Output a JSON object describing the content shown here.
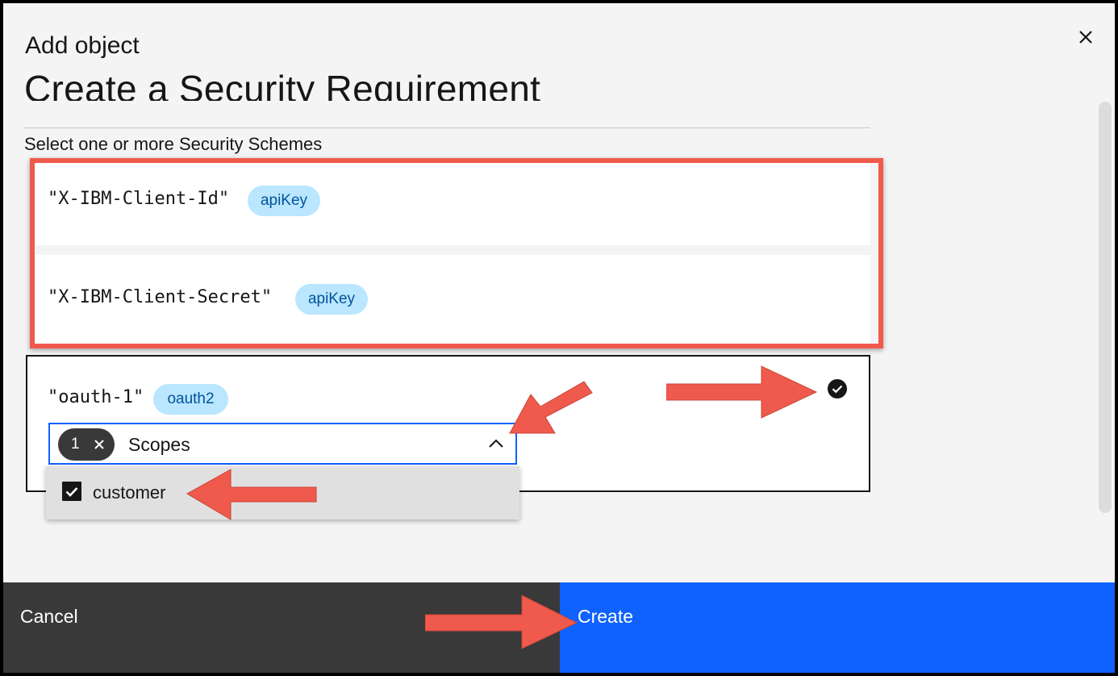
{
  "modal": {
    "label": "Add object",
    "heading": "Create a Security Requirement",
    "instruction": "Select one or more Security Schemes"
  },
  "schemes": [
    {
      "name": "\"X-IBM-Client-Id\"",
      "type": "apiKey"
    },
    {
      "name": "\"X-IBM-Client-Secret\"",
      "type": "apiKey"
    },
    {
      "name": "\"oauth-1\"",
      "type": "oauth2",
      "selected": true
    }
  ],
  "scopes": {
    "selected_count": "1",
    "label": "Scopes",
    "options": [
      {
        "label": "customer",
        "checked": true
      }
    ]
  },
  "footer": {
    "cancel_label": "Cancel",
    "create_label": "Create"
  },
  "colors": {
    "primary": "#0f62fe",
    "tag_bg": "#bae6ff",
    "tag_text": "#00539a",
    "annotation": "#ef5a4c",
    "dark_button": "#393939"
  },
  "icons": [
    "close-icon",
    "checkmark-filled-icon",
    "clear-icon",
    "chevron-up-icon",
    "checkbox-checked-icon"
  ]
}
